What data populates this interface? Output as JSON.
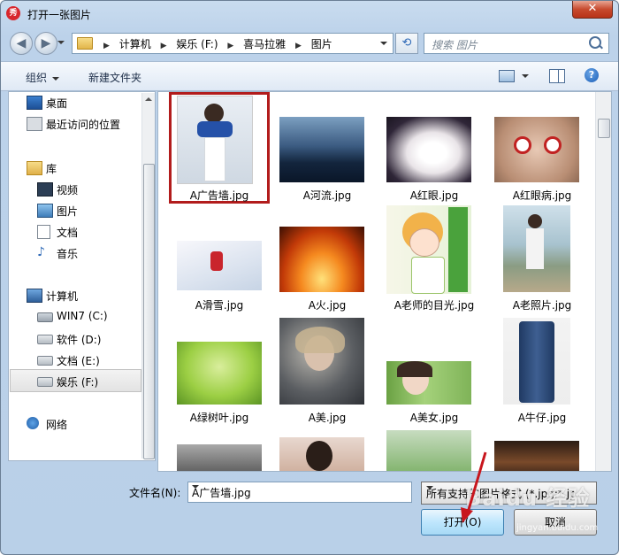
{
  "window": {
    "title": "打开一张图片",
    "app_icon": "秀",
    "close": "✕"
  },
  "nav": {
    "back_icon": "back-arrow-icon",
    "forward_icon": "forward-arrow-icon",
    "breadcrumb": [
      "计算机",
      "娱乐 (F:)",
      "喜马拉雅",
      "图片"
    ],
    "refresh_icon": "refresh-icon",
    "search_placeholder": "搜索 图片"
  },
  "toolbar": {
    "organize": "组织",
    "new_folder": "新建文件夹"
  },
  "sidebar": {
    "items": [
      {
        "label": "桌面",
        "icon": "desktop-icon"
      },
      {
        "label": "最近访问的位置",
        "icon": "recent-places-icon"
      },
      {
        "label": "库",
        "icon": "library-icon"
      },
      {
        "label": "视频",
        "icon": "video-icon"
      },
      {
        "label": "图片",
        "icon": "pictures-icon"
      },
      {
        "label": "文档",
        "icon": "documents-icon"
      },
      {
        "label": "音乐",
        "icon": "music-icon"
      },
      {
        "label": "计算机",
        "icon": "computer-icon"
      },
      {
        "label": "WIN7 (C:)",
        "icon": "drive-c-icon"
      },
      {
        "label": "软件 (D:)",
        "icon": "drive-icon"
      },
      {
        "label": "文档 (E:)",
        "icon": "drive-icon"
      },
      {
        "label": "娱乐 (F:)",
        "icon": "drive-icon"
      },
      {
        "label": "网络",
        "icon": "network-icon"
      }
    ],
    "selected": "娱乐 (F:)"
  },
  "files": [
    {
      "name": "A广告墙.jpg",
      "selected": true
    },
    {
      "name": "A河流.jpg"
    },
    {
      "name": "A红眼.jpg"
    },
    {
      "name": "A红眼病.jpg"
    },
    {
      "name": "A滑雪.jpg"
    },
    {
      "name": "A火.jpg"
    },
    {
      "name": "A老师的目光.jpg"
    },
    {
      "name": "A老照片.jpg"
    },
    {
      "name": "A绿树叶.jpg"
    },
    {
      "name": "A美.jpg"
    },
    {
      "name": "A美女.jpg"
    },
    {
      "name": "A牛仔.jpg"
    }
  ],
  "footer": {
    "filename_label": "文件名(N):",
    "filename_value": "A广告墙.jpg",
    "file_type": "所有支持的图片格式 (*.jpg;*.jp",
    "open_button": "打开(O)",
    "cancel_button": "取消"
  },
  "watermark": {
    "text": "Baidu 经验",
    "sub": "jingyan.baidu.com"
  }
}
